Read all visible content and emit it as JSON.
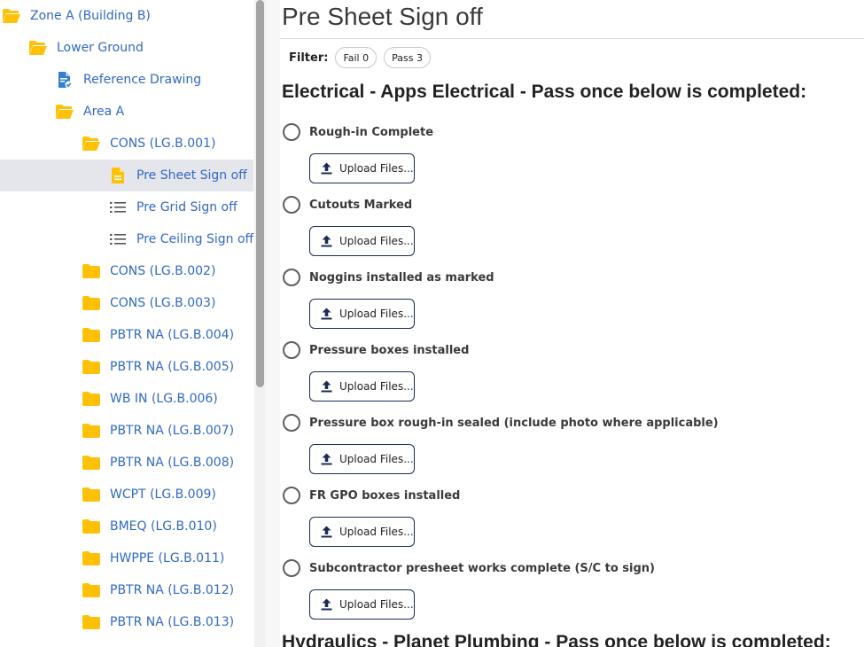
{
  "sidebar": {
    "items": [
      {
        "label": "Zone A (Building B)",
        "icon": "folder-open-icon"
      },
      {
        "label": "Lower Ground",
        "icon": "folder-open-icon"
      },
      {
        "label": "Reference Drawing",
        "icon": "document-check-icon"
      },
      {
        "label": "Area A",
        "icon": "folder-open-icon"
      },
      {
        "label": "CONS (LG.B.001)",
        "icon": "folder-open-icon"
      },
      {
        "label": "Pre Sheet Sign off",
        "icon": "document-icon",
        "selected": true
      },
      {
        "label": "Pre Grid Sign off",
        "icon": "list-icon"
      },
      {
        "label": "Pre Ceiling Sign off",
        "icon": "list-icon"
      },
      {
        "label": "CONS (LG.B.002)",
        "icon": "folder-icon"
      },
      {
        "label": "CONS (LG.B.003)",
        "icon": "folder-icon"
      },
      {
        "label": "PBTR NA (LG.B.004)",
        "icon": "folder-icon"
      },
      {
        "label": "PBTR NA (LG.B.005)",
        "icon": "folder-icon"
      },
      {
        "label": "WB IN (LG.B.006)",
        "icon": "folder-icon"
      },
      {
        "label": "PBTR NA (LG.B.007)",
        "icon": "folder-icon"
      },
      {
        "label": "PBTR NA (LG.B.008)",
        "icon": "folder-icon"
      },
      {
        "label": "WCPT (LG.B.009)",
        "icon": "folder-icon"
      },
      {
        "label": "BMEQ (LG.B.010)",
        "icon": "folder-icon"
      },
      {
        "label": "HWPPE (LG.B.011)",
        "icon": "folder-icon"
      },
      {
        "label": "PBTR NA (LG.B.012)",
        "icon": "folder-icon"
      },
      {
        "label": "PBTR NA (LG.B.013)",
        "icon": "folder-icon"
      }
    ]
  },
  "main": {
    "title": "Pre Sheet Sign off",
    "filter": {
      "label": "Filter:",
      "fail_label": "Fail 0",
      "pass_label": "Pass 3"
    },
    "sections": [
      {
        "heading": "Electrical - Apps Electrical - Pass once below is completed:",
        "items": [
          {
            "label": "Rough-in Complete",
            "upload_label": "Upload Files..."
          },
          {
            "label": "Cutouts Marked",
            "upload_label": "Upload Files..."
          },
          {
            "label": "Noggins installed as marked",
            "upload_label": "Upload Files..."
          },
          {
            "label": "Pressure boxes installed",
            "upload_label": "Upload Files..."
          },
          {
            "label": "Pressure box rough-in sealed (include photo where applicable)",
            "upload_label": "Upload Files..."
          },
          {
            "label": "FR GPO boxes installed",
            "upload_label": "Upload Files..."
          },
          {
            "label": "Subcontractor presheet works complete (S/C to sign)",
            "upload_label": "Upload Files..."
          }
        ]
      },
      {
        "heading": "Hydraulics - Planet Plumbing - Pass once below is completed:"
      }
    ]
  },
  "colors": {
    "link_blue": "#3169c6",
    "folder_yellow": "#ffc107",
    "selected_bg": "#e4e6eb",
    "upload_border": "#1a2b55"
  }
}
